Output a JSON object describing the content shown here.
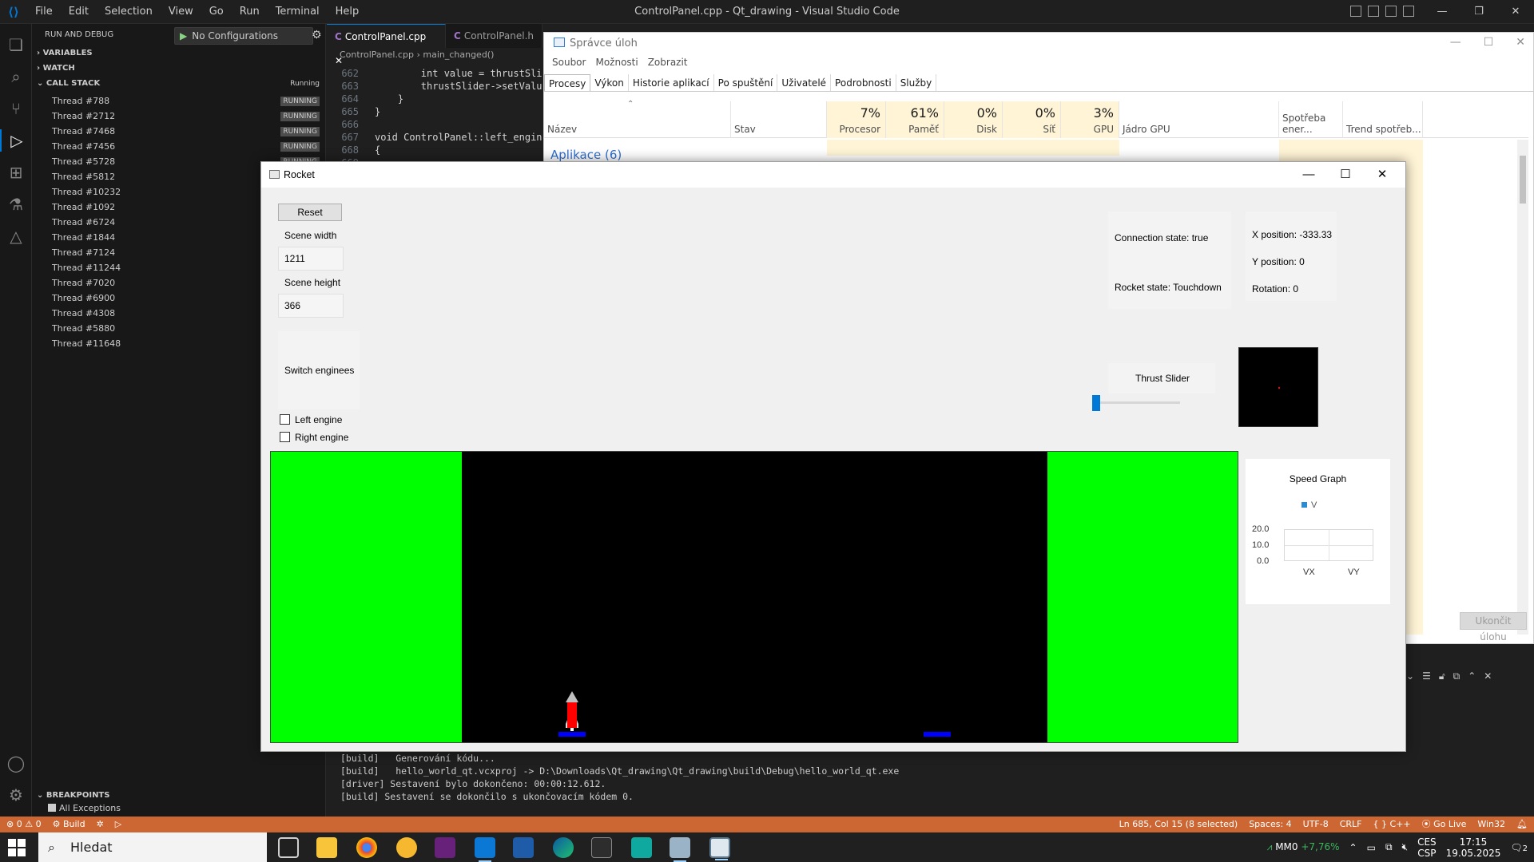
{
  "vscode": {
    "menu": [
      "File",
      "Edit",
      "Selection",
      "View",
      "Go",
      "Run",
      "Terminal",
      "Help"
    ],
    "window_title": "ControlPanel.cpp - Qt_drawing - Visual Studio Code",
    "sidebar": {
      "header": "RUN AND DEBUG",
      "config": "No Configurations",
      "sections": {
        "variables": "VARIABLES",
        "watch": "WATCH",
        "call_stack": "CALL STACK",
        "call_stack_status": "Running",
        "breakpoints": "BREAKPOINTS"
      },
      "threads": [
        {
          "name": "Thread #788",
          "status": "RUNNING"
        },
        {
          "name": "Thread #2712",
          "status": "RUNNING"
        },
        {
          "name": "Thread #7468",
          "status": "RUNNING"
        },
        {
          "name": "Thread #7456",
          "status": "RUNNING"
        },
        {
          "name": "Thread #5728",
          "status": "RUNNING"
        },
        {
          "name": "Thread #5812",
          "status": ""
        },
        {
          "name": "Thread #10232",
          "status": ""
        },
        {
          "name": "Thread #1092",
          "status": ""
        },
        {
          "name": "Thread #6724",
          "status": ""
        },
        {
          "name": "Thread #1844",
          "status": ""
        },
        {
          "name": "Thread #7124",
          "status": ""
        },
        {
          "name": "Thread #11244",
          "status": ""
        },
        {
          "name": "Thread #7020",
          "status": ""
        },
        {
          "name": "Thread #6900",
          "status": ""
        },
        {
          "name": "Thread #4308",
          "status": ""
        },
        {
          "name": "Thread #5880",
          "status": ""
        },
        {
          "name": "Thread #11648",
          "status": ""
        }
      ],
      "breakpoint_item": "All Exceptions"
    },
    "tabs": [
      {
        "label": "ControlPanel.cpp",
        "active": true
      },
      {
        "label": "ControlPanel.h",
        "active": false
      }
    ],
    "breadcrumb": {
      "file": "ControlPanel.cpp",
      "symbol": "main_changed()"
    },
    "code": [
      {
        "ln": "662",
        "text": "        int value = thrustSlider-"
      },
      {
        "ln": "663",
        "text": "        thrustSlider->setValue(va"
      },
      {
        "ln": "664",
        "text": "    }"
      },
      {
        "ln": "665",
        "text": "}"
      },
      {
        "ln": "666",
        "text": ""
      },
      {
        "ln": "667",
        "text": "void ControlPanel::left_engine_ch"
      },
      {
        "ln": "668",
        "text": "{"
      },
      {
        "ln": "669",
        "text": ""
      }
    ],
    "terminal": [
      "[build]   Generování kódu...",
      "[build]   hello_world_qt.vcxproj -> D:\\Downloads\\Qt_drawing\\Qt_drawing\\build\\Debug\\hello_world_qt.exe",
      "[driver] Sestavení bylo dokončeno: 00:00:12.612.",
      "[build] Sestavení se dokončilo s ukončovacím kódem 0."
    ],
    "statusbar": {
      "errors": "0",
      "warnings": "0",
      "build": "Build",
      "position": "Ln 685, Col 15 (8 selected)",
      "spaces": "Spaces: 4",
      "encoding": "UTF-8",
      "eol": "CRLF",
      "language": "C++",
      "golive": "Go Live",
      "platform": "Win32"
    }
  },
  "taskmgr": {
    "title": "Správce úloh",
    "menu": [
      "Soubor",
      "Možnosti",
      "Zobrazit"
    ],
    "tabs": [
      "Procesy",
      "Výkon",
      "Historie aplikací",
      "Po spuštění",
      "Uživatelé",
      "Podrobnosti",
      "Služby"
    ],
    "columns": [
      {
        "label": "Název",
        "pct": ""
      },
      {
        "label": "Stav",
        "pct": ""
      },
      {
        "label": "Procesor",
        "pct": "7%"
      },
      {
        "label": "Paměť",
        "pct": "61%"
      },
      {
        "label": "Disk",
        "pct": "0%"
      },
      {
        "label": "Síť",
        "pct": "0%"
      },
      {
        "label": "GPU",
        "pct": "3%"
      },
      {
        "label": "Jádro GPU",
        "pct": ""
      },
      {
        "label": "Spotřeba ener...",
        "pct": ""
      },
      {
        "label": "Trend spotřeb...",
        "pct": ""
      }
    ],
    "group": "Aplikace (6)",
    "end_task": "Ukončit úlohu"
  },
  "rocket": {
    "title": "Rocket",
    "reset": "Reset",
    "scene_width_label": "Scene width",
    "scene_width": "1211",
    "scene_height_label": "Scene height",
    "scene_height": "366",
    "switch_engines": "Switch enginees",
    "left_engine": "Left engine",
    "right_engine": "Right engine",
    "connection_state": "Connection state: true",
    "rocket_state": "Rocket state: Touchdown",
    "x_position": "X position: -333.33",
    "y_position": "Y position: 0",
    "rotation": "Rotation: 0",
    "thrust_label": "Thrust Slider",
    "thrust_value": 0,
    "speed_graph": {
      "title": "Speed Graph",
      "legend": "V",
      "y_ticks": [
        "20.0",
        "10.0",
        "0.0"
      ],
      "x_ticks": [
        "VX",
        "VY"
      ],
      "colors": {
        "series": "#2b8cd6"
      }
    },
    "colors": {
      "ground": "#00ff00",
      "sky": "#000000",
      "rocket_body": "#ff0000",
      "pad": "#0000ff"
    }
  },
  "taskbar": {
    "search": "Hledat",
    "stock_name": "MM0",
    "stock_change": "+7,76%",
    "lang_1": "CES",
    "lang_2": "CSP",
    "time": "17:15",
    "date": "19.05.2025",
    "notifications": "2"
  }
}
